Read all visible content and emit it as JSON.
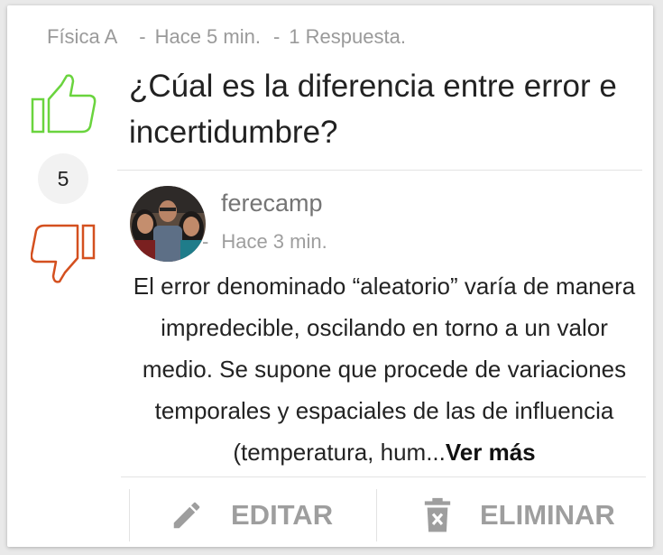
{
  "question": {
    "course": "Física A",
    "time_ago": "Hace 5 min.",
    "replies": "1 Respuesta.",
    "title": "¿Cúal es la diferencia entre error e incertidumbre?",
    "score": "5"
  },
  "answer": {
    "author": "ferecamp",
    "time_ago": "Hace 3 min.",
    "text": "El error denominado “aleatorio” varía de manera impredecible, oscilando en torno a un valor medio. Se supone que procede de variaciones temporales y espaciales de las de influencia (temperatura, hum...",
    "more_label": "Ver más"
  },
  "actions": {
    "edit_label": "EDITAR",
    "delete_label": "ELIMINAR"
  },
  "colors": {
    "upvote": "#6ad43e",
    "downvote": "#d4501f",
    "muted": "#9e9e9e"
  },
  "icons": {
    "upvote": "thumbs-up-icon",
    "downvote": "thumbs-down-icon",
    "edit": "pencil-icon",
    "delete": "trash-icon"
  }
}
